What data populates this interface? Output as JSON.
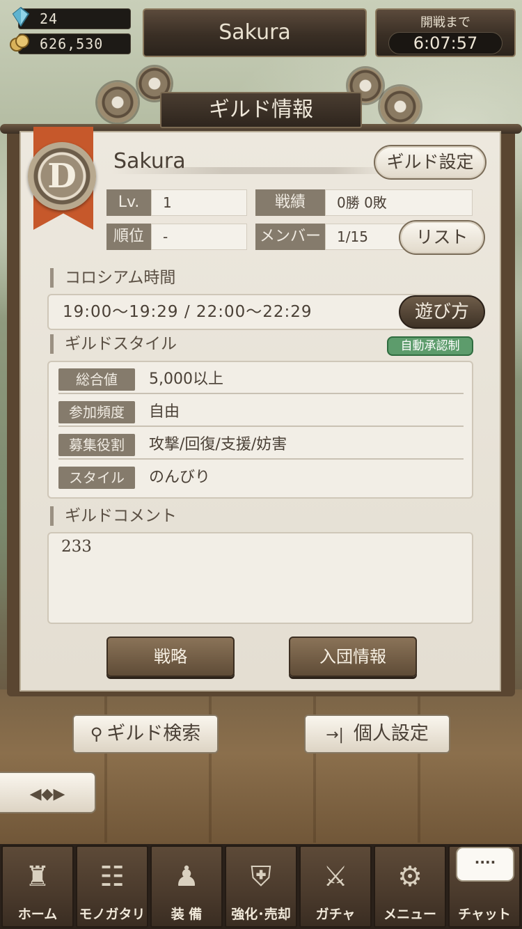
{
  "resources": {
    "gems": "24",
    "gold": "626,530"
  },
  "header": {
    "player_name": "Sakura",
    "timer_label": "開戦まで",
    "timer_value": "6:07:57"
  },
  "panel": {
    "title": "ギルド情報",
    "emblem_letter": "D",
    "guild_name": "Sakura",
    "settings_button": "ギルド設定",
    "stats": {
      "level_label": "Lv.",
      "level_value": "1",
      "record_label": "戦績",
      "record_value": "0勝  0敗",
      "rank_label": "順位",
      "rank_value": "-",
      "members_label": "メンバー",
      "members_value": "1/15",
      "list_button": "リスト"
    },
    "colosseum": {
      "title": "コロシアム時間",
      "times": "19:00〜19:29  /  22:00〜22:29",
      "howto_button": "遊び方"
    },
    "style": {
      "title": "ギルドスタイル",
      "badge": "自動承認制",
      "rows": [
        {
          "label": "総合値",
          "value": "5,000以上"
        },
        {
          "label": "参加頻度",
          "value": "自由"
        },
        {
          "label": "募集役割",
          "value": "攻撃/回復/支援/妨害"
        },
        {
          "label": "スタイル",
          "value": "のんびり"
        }
      ]
    },
    "comment": {
      "title": "ギルドコメント",
      "text": "233"
    },
    "actions": {
      "strategy": "戦略",
      "join_info": "入団情報"
    }
  },
  "buttons": {
    "guild_search": "ギルド検索",
    "personal_settings": "個人設定",
    "back_icon": "◀◆▶"
  },
  "nav": {
    "items": [
      {
        "label": "ホーム",
        "icon": "castle-icon"
      },
      {
        "label": "モノガタリ",
        "icon": "book-icon"
      },
      {
        "label": "装 備",
        "icon": "puppet-icon"
      },
      {
        "label": "強化･売却",
        "icon": "shield-icon"
      },
      {
        "label": "ガチャ",
        "icon": "swords-icon"
      },
      {
        "label": "メニュー",
        "icon": "gear-icon"
      },
      {
        "label": "チャット",
        "icon": "chat-icon"
      }
    ],
    "chat_bubble": "····"
  },
  "colors": {
    "auto_badge": "#5d9c6c",
    "ribbon": "#c6582b"
  }
}
